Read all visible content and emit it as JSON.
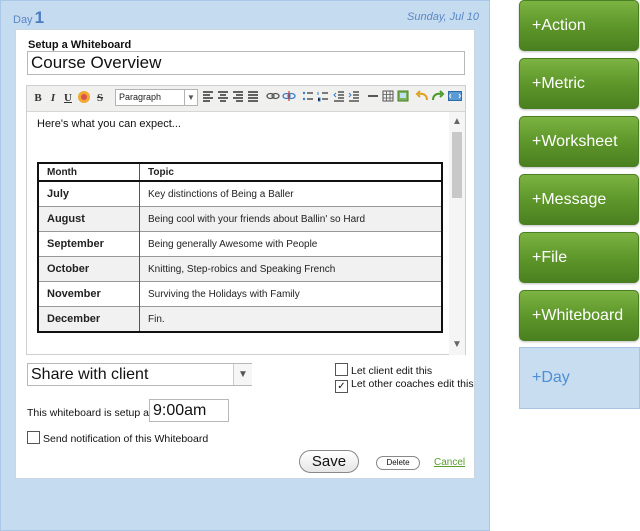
{
  "day": {
    "label": "Day",
    "number": "1",
    "date": "Sunday, Jul 10"
  },
  "whiteboard": {
    "section_title": "Setup a Whiteboard",
    "name": "Course Overview",
    "toolbar": {
      "bold": "B",
      "italic": "I",
      "underline": "U",
      "strike": "S",
      "paragraph": "Paragraph"
    },
    "intro": "Here's what you can expect...",
    "table": {
      "headers": [
        "Month",
        "Topic"
      ],
      "rows": [
        [
          "July",
          "Key distinctions of Being a Baller"
        ],
        [
          "August",
          "Being cool with your friends about Ballin' so Hard"
        ],
        [
          "September",
          "Being generally Awesome with People"
        ],
        [
          "October",
          "Knitting, Step-robics and Speaking French"
        ],
        [
          "November",
          "Surviving the Holidays with Family"
        ],
        [
          "December",
          "Fin."
        ]
      ]
    },
    "share_option": "Share with client",
    "let_client_edit": "Let client edit this",
    "let_coaches_edit": "Let other coaches edit this",
    "let_client_edit_checked": false,
    "let_coaches_edit_checked": true,
    "setup_label": "This whiteboard is setup at",
    "setup_time": "9:00am",
    "send_notification": "Send notification of this Whiteboard",
    "save": "Save",
    "delete": "Delete",
    "cancel": "Cancel"
  },
  "actions": [
    "+Action",
    "+Metric",
    "+Worksheet",
    "+Message",
    "+File",
    "+Whiteboard"
  ],
  "day_button": "+Day",
  "colors": {
    "panel_bg": "#c5dbf0",
    "action_green": "#5e972a",
    "day_blue": "#4d8fd0",
    "cancel_green": "#5a9e2e"
  }
}
